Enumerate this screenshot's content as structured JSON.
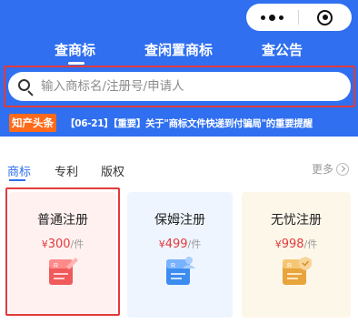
{
  "header": {
    "tabs": [
      {
        "label": "查商标",
        "active": true
      },
      {
        "label": "查闲置商标",
        "active": false
      },
      {
        "label": "查公告",
        "active": false
      }
    ],
    "capsule": {
      "more_icon": "more-dots-icon",
      "close_icon": "target-circle-icon"
    }
  },
  "search": {
    "placeholder": "输入商标名/注册号/申请人",
    "value": ""
  },
  "news": {
    "badge": "知产头条",
    "text": "【06-21】【重要】关于\"商标文件快递到付骗局\"的重要提醒"
  },
  "categories": {
    "items": [
      {
        "label": "商标",
        "active": true
      },
      {
        "label": "专利",
        "active": false
      },
      {
        "label": "版权",
        "active": false
      }
    ],
    "more_label": "更多"
  },
  "cards": [
    {
      "title": "普通注册",
      "currency": "¥",
      "price": "300",
      "unit": "/件",
      "icon": "document-pen-icon",
      "selected": true
    },
    {
      "title": "保姆注册",
      "currency": "¥",
      "price": "499",
      "unit": "/件",
      "icon": "document-person-icon",
      "selected": false
    },
    {
      "title": "无忧注册",
      "currency": "¥",
      "price": "998",
      "unit": "/件",
      "icon": "document-shield-icon",
      "selected": false
    }
  ],
  "colors": {
    "primary": "#2f6ff0",
    "highlight_outline": "#e23b3b",
    "price": "#e23b3b",
    "news_badge": "#ff6a1a"
  }
}
